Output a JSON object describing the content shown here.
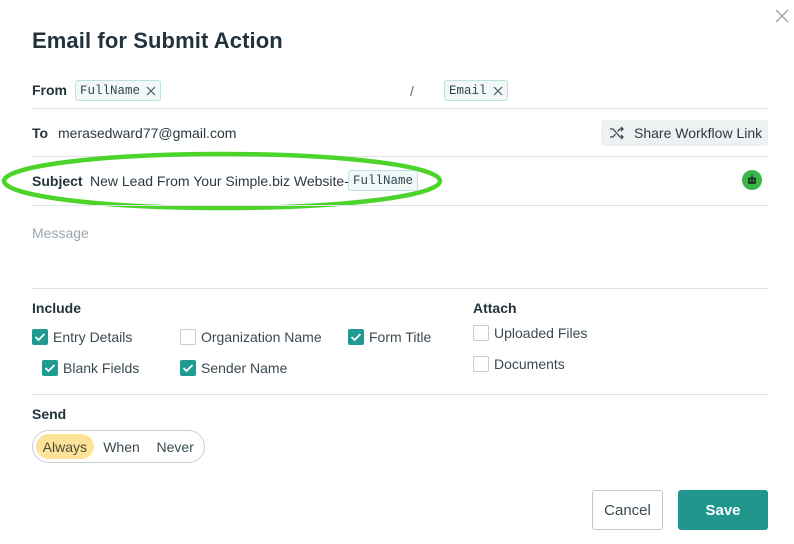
{
  "dialog": {
    "title": "Email for Submit Action",
    "close_icon": "close-icon"
  },
  "from": {
    "label": "From",
    "name_tag": "FullName",
    "separator": "/",
    "email_tag": "Email"
  },
  "to": {
    "label": "To",
    "value": "merasedward77@gmail.com",
    "share_button": "Share Workflow Link",
    "share_icon": "shuffle-icon"
  },
  "subject": {
    "label": "Subject",
    "text": "New Lead From Your Simple.biz Website-",
    "tag": "FullName",
    "assistant_icon": "robot-icon",
    "highlight_color": "#4cd42a"
  },
  "message": {
    "placeholder": "Message"
  },
  "include": {
    "label": "Include",
    "options": [
      {
        "label": "Entry Details",
        "checked": true
      },
      {
        "label": "Organization Name",
        "checked": false
      },
      {
        "label": "Form Title",
        "checked": true
      },
      {
        "label": "Blank Fields",
        "checked": true
      },
      {
        "label": "Sender Name",
        "checked": true
      }
    ]
  },
  "attach": {
    "label": "Attach",
    "options": [
      {
        "label": "Uploaded Files",
        "checked": false
      },
      {
        "label": "Documents",
        "checked": false
      }
    ]
  },
  "send": {
    "label": "Send",
    "options": [
      "Always",
      "When",
      "Never"
    ],
    "selected": "Always"
  },
  "footer": {
    "cancel": "Cancel",
    "save": "Save"
  },
  "colors": {
    "accent": "#21968d",
    "checkbox": "#1f9b91",
    "segment_active": "#fde39a",
    "robot": "#39b54a"
  }
}
